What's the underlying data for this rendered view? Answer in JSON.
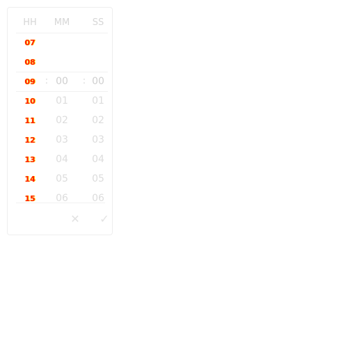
{
  "time_picker": {
    "header": {
      "hours": "HH",
      "minutes": "MM",
      "seconds": "SS"
    },
    "separator": ":",
    "selected": {
      "hour": "09",
      "minute": "00",
      "second": "00"
    },
    "rows_above": [
      {
        "hour": "07"
      },
      {
        "hour": "08"
      }
    ],
    "rows_below": [
      {
        "hour": "10",
        "minute": "01",
        "second": "01"
      },
      {
        "hour": "11",
        "minute": "02",
        "second": "02"
      },
      {
        "hour": "12",
        "minute": "03",
        "second": "03"
      },
      {
        "hour": "13",
        "minute": "04",
        "second": "04"
      },
      {
        "hour": "14",
        "minute": "05",
        "second": "05"
      },
      {
        "hour": "15",
        "minute": "06",
        "second": "06"
      }
    ],
    "actions": {
      "cancel_icon": "close-icon",
      "confirm_icon": "check-icon",
      "cancel_glyph": "✕",
      "confirm_glyph": "✓"
    },
    "colors": {
      "border": "#eeeeee",
      "text_muted": "#dcdcdc",
      "hour_highlight": "#ff1a00",
      "hour_glow": "#ffe000"
    }
  }
}
